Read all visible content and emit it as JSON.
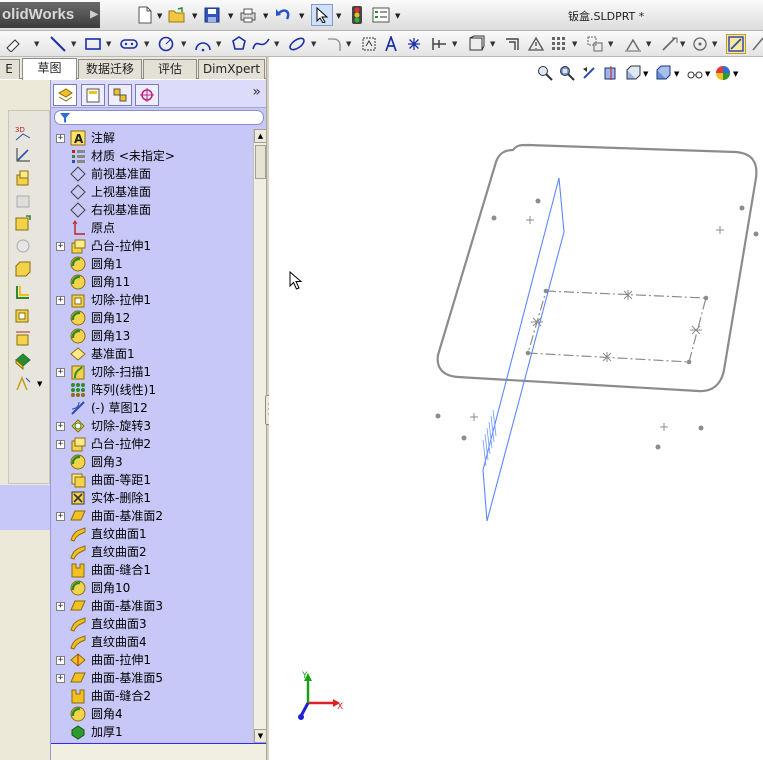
{
  "app": {
    "brand": "olidWorks",
    "document_title": "钣盒.SLDPRT *"
  },
  "tabs": [
    {
      "label": "E",
      "active": false
    },
    {
      "label": "草图",
      "active": true
    },
    {
      "label": "数据迁移",
      "active": false
    },
    {
      "label": "评估",
      "active": false
    },
    {
      "label": "DimXpert",
      "active": false
    }
  ],
  "feature_tree": {
    "items": [
      {
        "label": "注解",
        "expand": true,
        "icon": "annotations-icon"
      },
      {
        "label": "材质 <未指定>",
        "expand": false,
        "icon": "material-icon"
      },
      {
        "label": "前视基准面",
        "expand": false,
        "icon": "plane-icon"
      },
      {
        "label": "上视基准面",
        "expand": false,
        "icon": "plane-icon"
      },
      {
        "label": "右视基准面",
        "expand": false,
        "icon": "plane-icon"
      },
      {
        "label": "原点",
        "expand": false,
        "icon": "origin-icon"
      },
      {
        "label": "凸台-拉伸1",
        "expand": true,
        "icon": "boss-extrude-icon"
      },
      {
        "label": "圆角1",
        "expand": false,
        "icon": "fillet-icon"
      },
      {
        "label": "圆角11",
        "expand": false,
        "icon": "fillet-icon"
      },
      {
        "label": "切除-拉伸1",
        "expand": true,
        "icon": "cut-extrude-icon"
      },
      {
        "label": "圆角12",
        "expand": false,
        "icon": "fillet-icon"
      },
      {
        "label": "圆角13",
        "expand": false,
        "icon": "fillet-icon"
      },
      {
        "label": "基准面1",
        "expand": false,
        "icon": "ref-plane-icon"
      },
      {
        "label": "切除-扫描1",
        "expand": true,
        "icon": "cut-sweep-icon"
      },
      {
        "label": "阵列(线性)1",
        "expand": false,
        "icon": "linear-pattern-icon"
      },
      {
        "label": "(-) 草图12",
        "expand": false,
        "icon": "sketch-icon"
      },
      {
        "label": "切除-旋转3",
        "expand": true,
        "icon": "cut-revolve-icon"
      },
      {
        "label": "凸台-拉伸2",
        "expand": true,
        "icon": "boss-extrude-icon"
      },
      {
        "label": "圆角3",
        "expand": false,
        "icon": "fillet-icon"
      },
      {
        "label": "曲面-等距1",
        "expand": false,
        "icon": "offset-surface-icon"
      },
      {
        "label": "实体-删除1",
        "expand": false,
        "icon": "delete-body-icon"
      },
      {
        "label": "曲面-基准面2",
        "expand": true,
        "icon": "planar-surface-icon"
      },
      {
        "label": "直纹曲面1",
        "expand": false,
        "icon": "ruled-surface-icon"
      },
      {
        "label": "直纹曲面2",
        "expand": false,
        "icon": "ruled-surface-icon"
      },
      {
        "label": "曲面-缝合1",
        "expand": false,
        "icon": "knit-surface-icon"
      },
      {
        "label": "圆角10",
        "expand": false,
        "icon": "fillet-icon"
      },
      {
        "label": "曲面-基准面3",
        "expand": true,
        "icon": "planar-surface-icon"
      },
      {
        "label": "直纹曲面3",
        "expand": false,
        "icon": "ruled-surface-icon"
      },
      {
        "label": "直纹曲面4",
        "expand": false,
        "icon": "ruled-surface-icon"
      },
      {
        "label": "曲面-拉伸1",
        "expand": true,
        "icon": "extrude-surface-icon"
      },
      {
        "label": "曲面-基准面5",
        "expand": true,
        "icon": "planar-surface-icon"
      },
      {
        "label": "曲面-缝合2",
        "expand": false,
        "icon": "knit-surface-icon"
      },
      {
        "label": "圆角4",
        "expand": false,
        "icon": "fillet-icon"
      },
      {
        "label": "加厚1",
        "expand": false,
        "icon": "thicken-icon"
      }
    ]
  },
  "triad": {
    "x_label": "X",
    "y_label": "Y"
  },
  "colors": {
    "tree_background": "#c8c8f8",
    "model_edge": "#8c8c8c",
    "plane_edge": "#5f86ff",
    "triad_x": "#e02020",
    "triad_y": "#18a018",
    "triad_z": "#2020d0"
  }
}
